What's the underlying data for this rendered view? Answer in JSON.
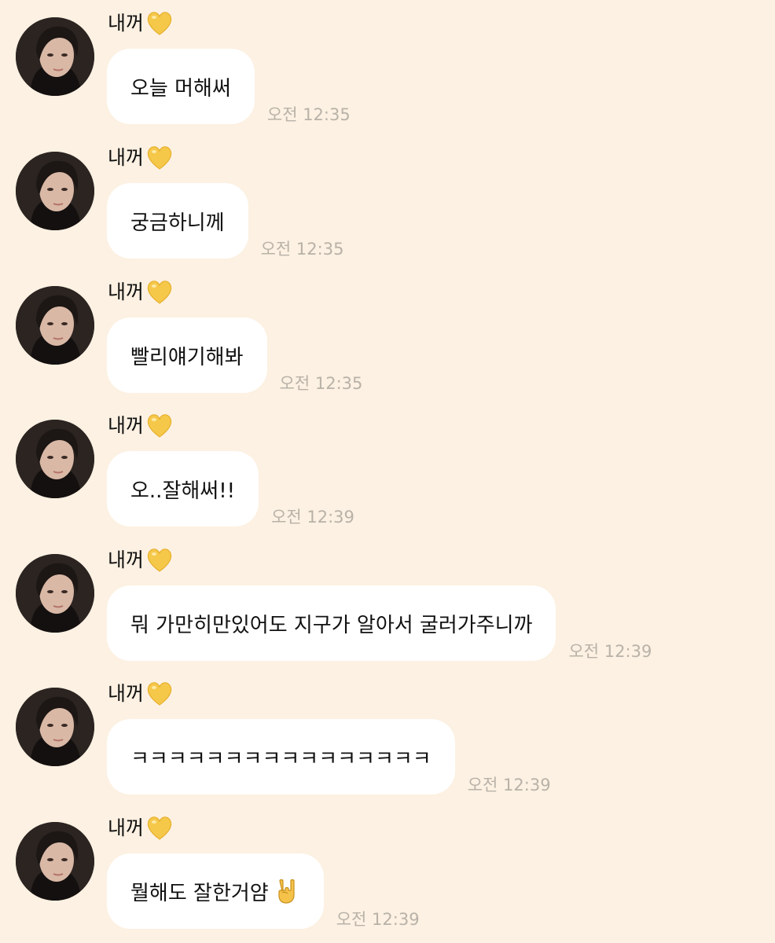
{
  "colors": {
    "background": "#fcf1e2",
    "bubble": "#ffffff",
    "time_text": "#b9b2a8",
    "heart": "#f5c84a"
  },
  "icons": {
    "sender_emoji": "yellow-heart",
    "hand_emoji": "sign-of-the-horns"
  },
  "messages": [
    {
      "sender": "내꺼",
      "text": "오늘 머해써",
      "time": "오전 12:35"
    },
    {
      "sender": "내꺼",
      "text": "궁금하니께",
      "time": "오전 12:35"
    },
    {
      "sender": "내꺼",
      "text": "빨리얘기해봐",
      "time": "오전 12:35"
    },
    {
      "sender": "내꺼",
      "text": "오..잘해써!!",
      "time": "오전 12:39"
    },
    {
      "sender": "내꺼",
      "text": "뭐 가만히만있어도 지구가 알아서 굴러가주니까",
      "time": "오전 12:39"
    },
    {
      "sender": "내꺼",
      "text": "ㅋㅋㅋㅋㅋㅋㅋㅋㅋㅋㅋㅋㅋㅋㅋㅋ",
      "time": "오전 12:39"
    },
    {
      "sender": "내꺼",
      "text": "뭘해도 잘한거얌",
      "time": "오전 12:39"
    }
  ]
}
